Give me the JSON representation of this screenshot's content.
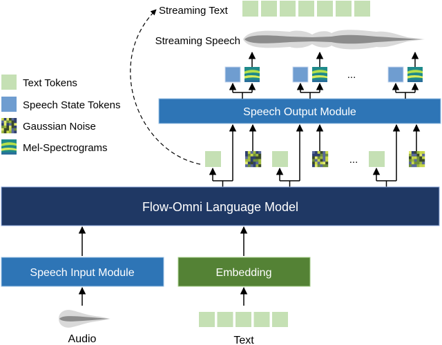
{
  "legend": {
    "text_tokens": "Text Tokens",
    "speech_state_tokens": "Speech State Tokens",
    "gaussian_noise": "Gaussian Noise",
    "mel_spectrograms": "Mel-Spectrograms"
  },
  "outputs": {
    "streaming_text": "Streaming Text",
    "streaming_speech": "Streaming Speech"
  },
  "modules": {
    "speech_output": "Speech Output Module",
    "language_model": "Flow-Omni Language Model",
    "speech_input": "Speech Input Module",
    "embedding": "Embedding"
  },
  "inputs": {
    "audio": "Audio",
    "text": "Text"
  },
  "ellipsis": "...",
  "colors": {
    "text_token": "#c5e0b4",
    "speech_state_token": "#6f9dd0",
    "speech_output_module": "#2e75b6",
    "language_model": "#1f3864",
    "speech_input_module": "#2e75b6",
    "embedding": "#548235",
    "arrow": "#000000"
  }
}
